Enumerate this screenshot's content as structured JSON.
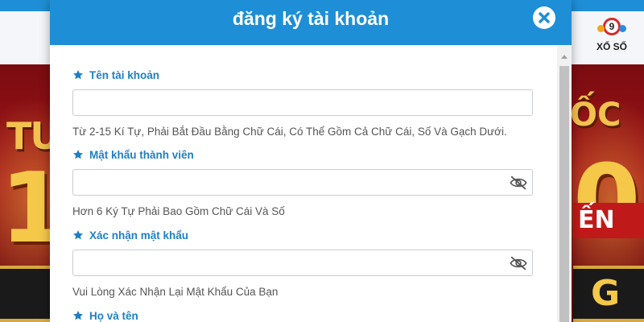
{
  "background": {
    "nav": {
      "xoso_label": "XỔ SỐ",
      "xoso_ball_number": "9"
    },
    "banner": {
      "left_text": "TU",
      "left_big_text": "1",
      "right_text": "ỐC",
      "right_big_text": "0",
      "right_ribbon_text": "ẾN",
      "right_plate_text": "G"
    }
  },
  "modal": {
    "title": "đăng ký tài khoản",
    "close_label": "close",
    "fields": [
      {
        "label": "Tên tài khoản",
        "value": "",
        "placeholder": "",
        "hint": "Từ 2-15 Kí Tự, Phải Bắt Đầu Bằng Chữ Cái, Có Thể Gồm Cả Chữ Cái, Số Và Gạch Dưới.",
        "icon": "star-icon"
      },
      {
        "label": "Mật khẩu thành viên",
        "value": "",
        "placeholder": "",
        "hint": "Hơn 6 Ký Tự Phải Bao Gồm Chữ Cái Và Số",
        "icon": "star-icon",
        "toggle_icon": "eye-slash-icon"
      },
      {
        "label": "Xác nhận mật khẩu",
        "value": "",
        "placeholder": "",
        "hint": "Vui Lòng Xác Nhận Lại Mật Khẩu Của Bạn",
        "icon": "star-icon",
        "toggle_icon": "eye-slash-icon"
      },
      {
        "label": "Họ và tên",
        "icon": "star-icon"
      }
    ]
  },
  "colors": {
    "header_blue": "#1e8fd6",
    "label_blue": "#1e7fc4",
    "hint_gray": "#555555",
    "banner_red": "#a3141a",
    "banner_gold": "#f5c84a"
  }
}
